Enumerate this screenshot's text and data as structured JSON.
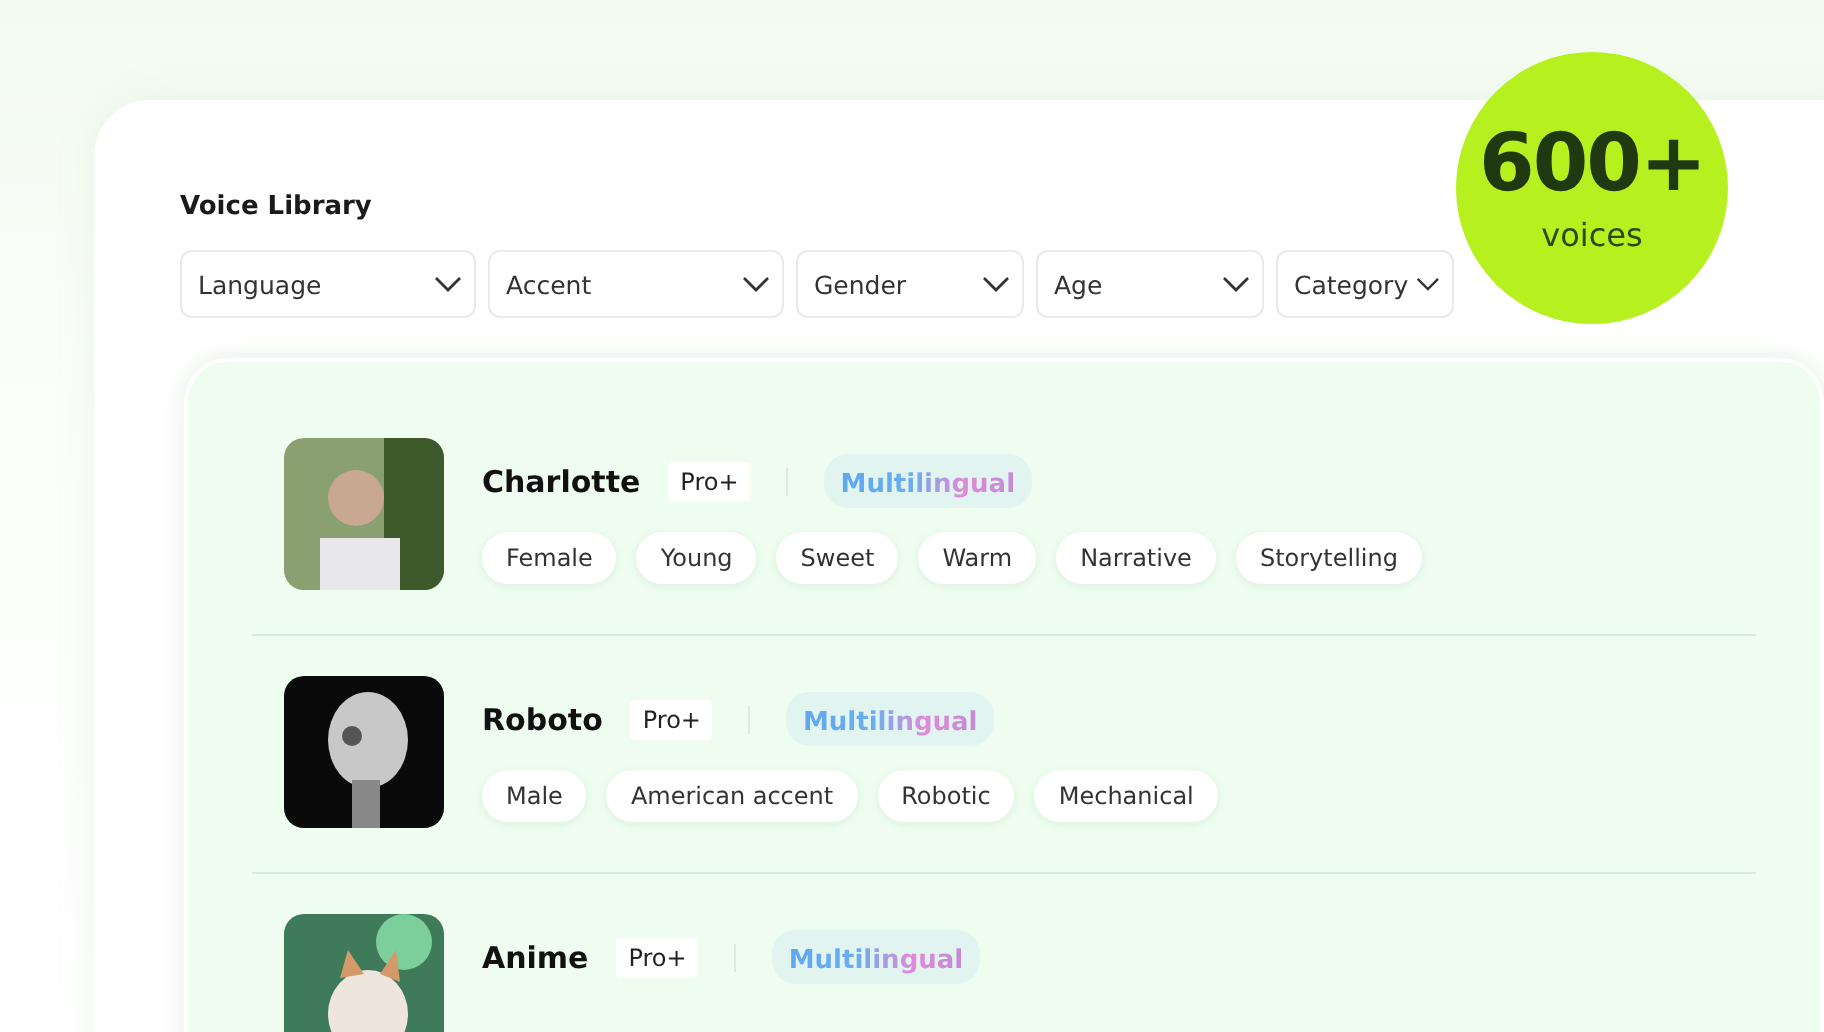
{
  "title": "Voice Library",
  "filters": [
    {
      "label": "Language"
    },
    {
      "label": "Accent"
    },
    {
      "label": "Gender"
    },
    {
      "label": "Age"
    },
    {
      "label": "Category"
    }
  ],
  "badge": {
    "count": "600+",
    "label": "voices"
  },
  "voices": [
    {
      "name": "Charlotte",
      "plan": "Pro+",
      "language_tag": "Multilingual",
      "kind": "photo",
      "tags": [
        "Female",
        "Young",
        "Sweet",
        "Warm",
        "Narrative",
        "Storytelling"
      ]
    },
    {
      "name": "Roboto",
      "plan": "Pro+",
      "language_tag": "Multilingual",
      "kind": "robot",
      "tags": [
        "Male",
        "American accent",
        "Robotic",
        "Mechanical"
      ]
    },
    {
      "name": "Anime",
      "plan": "Pro+",
      "language_tag": "Multilingual",
      "kind": "illustration"
    }
  ]
}
